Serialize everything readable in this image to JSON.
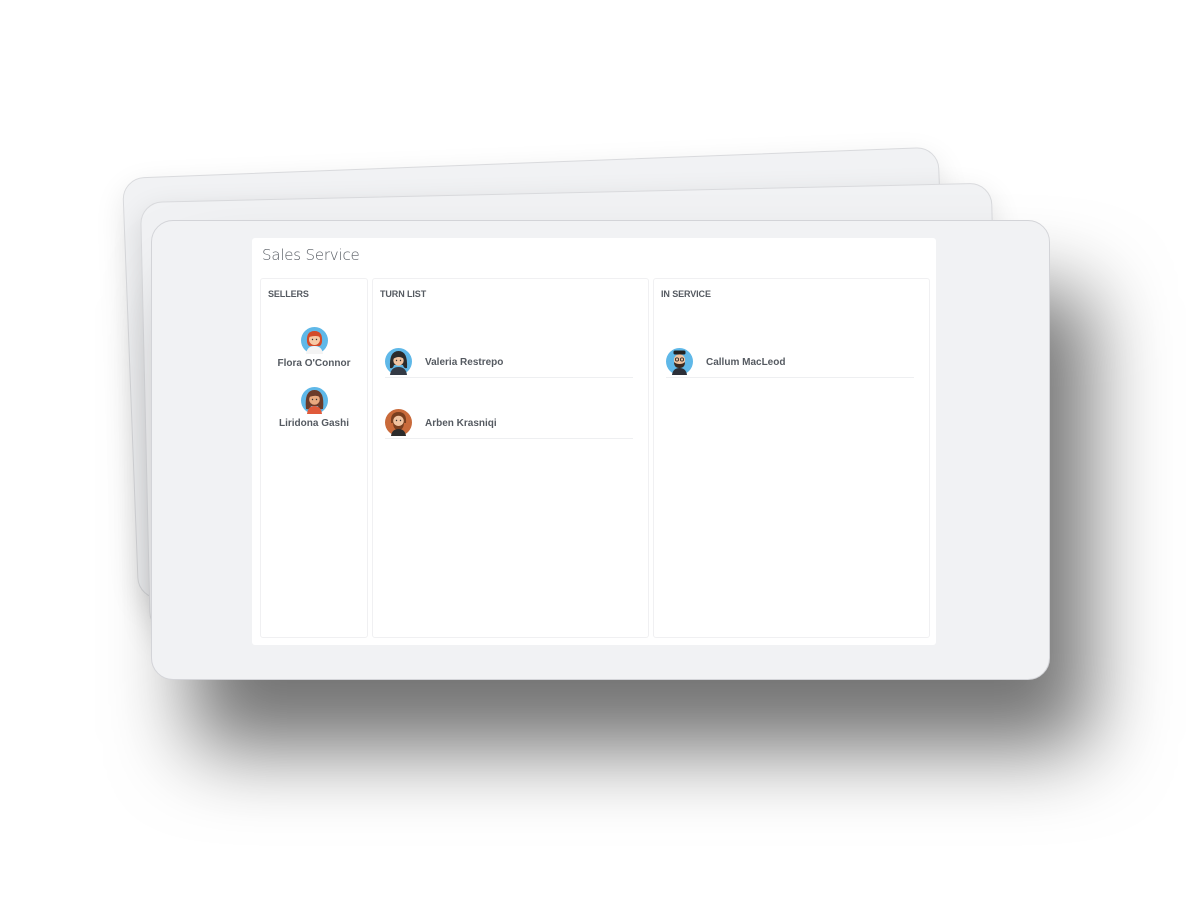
{
  "app": {
    "title": "Sales Service"
  },
  "sellers": {
    "header": "SELLERS",
    "items": [
      {
        "name": "Flora O'Connor",
        "avatar": "woman-red-hair-avatar-icon"
      },
      {
        "name": "Liridona Gashi",
        "avatar": "woman-brown-hair-avatar-icon"
      }
    ]
  },
  "turn_list": {
    "header": "TURN LIST",
    "items": [
      {
        "name": "Valeria Restrepo",
        "avatar": "woman-dark-hair-avatar-icon"
      },
      {
        "name": "Arben Krasniqi",
        "avatar": "man-beard-avatar-icon"
      }
    ]
  },
  "in_service": {
    "header": "IN SERVICE",
    "items": [
      {
        "name": "Callum MacLeod",
        "avatar": "man-glasses-avatar-icon"
      }
    ]
  },
  "colors": {
    "avatar_bg_blue": "#5fb8e8",
    "card_bg": "#f1f2f4",
    "text": "#555a61"
  }
}
